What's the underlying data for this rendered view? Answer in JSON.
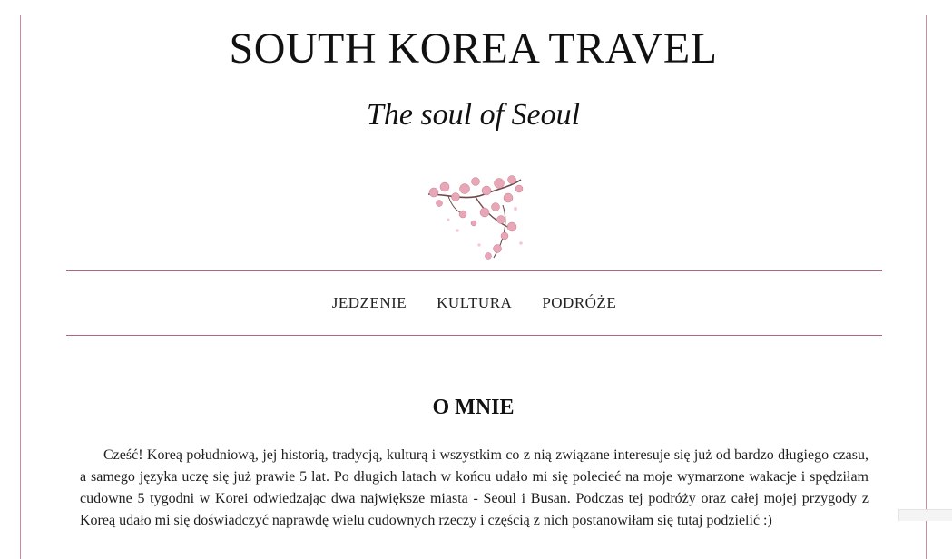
{
  "site": {
    "title": "SOUTH KOREA TRAVEL",
    "tagline": "The soul of Seoul",
    "accent_color": "#b0687f"
  },
  "header_image": {
    "icon": "cherry-blossom-branch"
  },
  "nav": {
    "items": [
      {
        "label": "JEDZENIE"
      },
      {
        "label": "KULTURA"
      },
      {
        "label": "PODRÓŻE"
      }
    ]
  },
  "about": {
    "heading": "O MNIE",
    "text": "Cześć! Koreą południową, jej historią, tradycją, kulturą i wszystkim co z nią związane interesuje się już od bardzo długiego czasu, a samego języka uczę się już prawie 5 lat. Po długich latach w końcu udało mi się polecieć na moje wymarzone wakacje i spędziłam cudowne 5 tygodni w Korei odwiedzając dwa największe miasta - Seoul i Busan. Podczas tej podróży oraz całej mojej przygody z Koreą udało mi się doświadczyć naprawdę wielu cudownych rzeczy i częścią z nich postanowiłam się tutaj podzielić :)"
  }
}
